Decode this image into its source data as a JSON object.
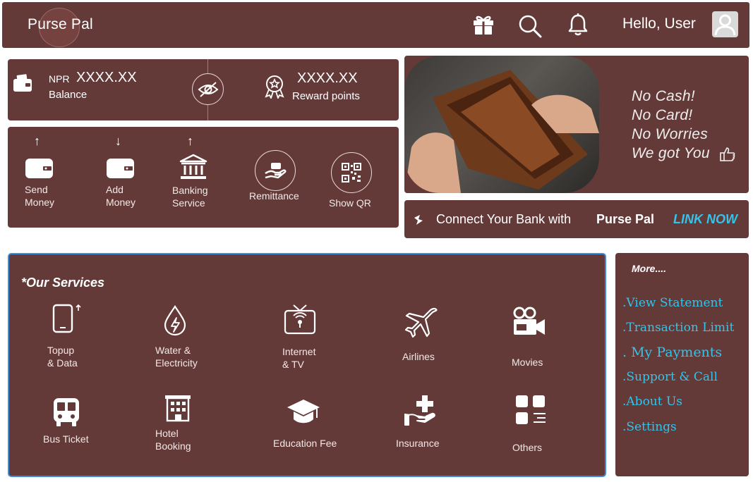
{
  "header": {
    "app_name": "Purse Pal",
    "greeting": "Hello, User",
    "icons": [
      "gift-icon",
      "search-icon",
      "bell-icon",
      "user-avatar-icon"
    ]
  },
  "balance": {
    "currency": "NPR",
    "amount": "XXXX.XX",
    "label": "Balance",
    "reward_amount": "XXXX.XX",
    "reward_label": "Reward points"
  },
  "actions": [
    {
      "line1": "Send",
      "line2": "Money",
      "icon": "wallet-icon",
      "arrow": "↑"
    },
    {
      "line1": "Add",
      "line2": "Money",
      "icon": "wallet-icon",
      "arrow": "↓"
    },
    {
      "line1": "Banking",
      "line2": "Service",
      "icon": "bank-icon",
      "arrow": "↑"
    },
    {
      "line1": "Remittance",
      "icon": "hand-money-icon"
    },
    {
      "line1": "Show QR",
      "icon": "qr-code-icon"
    }
  ],
  "promo": {
    "lines": [
      "No Cash!",
      "No Card!",
      "No Worries",
      "We got You"
    ]
  },
  "link_bar": {
    "text": "Connect Your Bank with",
    "brand": "Purse Pal",
    "cta": "LINK NOW"
  },
  "services": {
    "title": "*Our Services",
    "items": [
      {
        "line1": "Topup",
        "line2": "& Data",
        "icon": "phone-topup-icon"
      },
      {
        "line1": "Water &",
        "line2": "Electricity",
        "icon": "water-electricity-icon"
      },
      {
        "line1": "Internet",
        "line2": "& TV",
        "icon": "tv-icon"
      },
      {
        "line1": "Airlines",
        "icon": "airplane-icon"
      },
      {
        "line1": "Movies",
        "icon": "movie-camera-icon"
      },
      {
        "line1": "Bus Ticket",
        "icon": "bus-icon"
      },
      {
        "line1": "Hotel",
        "line2": "Booking",
        "icon": "hotel-icon"
      },
      {
        "line1": "Education Fee",
        "icon": "graduation-cap-icon"
      },
      {
        "line1": "Insurance",
        "icon": "insurance-hand-icon"
      },
      {
        "line1": "Others",
        "icon": "grid-icon"
      }
    ]
  },
  "more": {
    "title": "More....",
    "links": [
      ".View Statement",
      ".Transaction Limit",
      ". My Payments",
      ".Support & Call",
      ".About Us",
      ".Settings"
    ]
  },
  "colors": {
    "panel": "#643a38",
    "accent_link": "#34c3ea",
    "services_border": "#3a8edb"
  }
}
